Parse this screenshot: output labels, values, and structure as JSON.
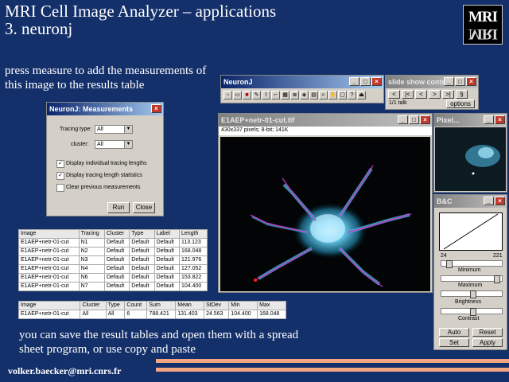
{
  "title": {
    "line1": "MRI Cell Image Analyzer – applications",
    "line2": "3. neuronj"
  },
  "logo": {
    "text": "MRI",
    "reflection": "MRI"
  },
  "instruction": "press measure to add the measurements of this image to the results table",
  "save_note": "you can save the result tables and open them with a spread sheet program, or use copy and paste",
  "footer": {
    "email": "volker.baecker@mri.cnrs.fr",
    "accent_color": "#f4a582"
  },
  "measurements_dialog": {
    "title": "NeuronJ: Measurements",
    "tracing_type_label": "Tracing type:",
    "tracing_type_value": "All",
    "cluster_label": "cluster:",
    "cluster_value": "All",
    "checkboxes": [
      {
        "label": "Display individual tracing lengths",
        "checked": true
      },
      {
        "label": "Display tracing length statistics",
        "checked": true
      },
      {
        "label": "Clear previous measurements",
        "checked": false
      }
    ],
    "run_label": "Run",
    "close_label": "Close"
  },
  "results_table": {
    "headers": [
      "Image",
      "Tracing",
      "Cluster",
      "Type",
      "Label",
      "Length"
    ],
    "rows": [
      [
        "E1AEP+netr-01-cut",
        "N1",
        "Default",
        "Default",
        "Default",
        "113.123"
      ],
      [
        "E1AEP+netr-01-cut",
        "N2",
        "Default",
        "Default",
        "Default",
        "168.048"
      ],
      [
        "E1AEP+netr-01-cut",
        "N3",
        "Default",
        "Default",
        "Default",
        "121.976"
      ],
      [
        "E1AEP+netr-01-cut",
        "N4",
        "Default",
        "Default",
        "Default",
        "127.052"
      ],
      [
        "E1AEP+netr-01-cut",
        "N6",
        "Default",
        "Default",
        "Default",
        "153.822"
      ],
      [
        "E1AEP+netr-01-cut",
        "N7",
        "Default",
        "Default",
        "Default",
        "104.400"
      ]
    ]
  },
  "stats_table": {
    "headers": [
      "Image",
      "Cluster",
      "Type",
      "Count",
      "Sum",
      "Mean",
      "StDev",
      "Min",
      "Max"
    ],
    "rows": [
      [
        "E1AEP+netr-01-cut",
        "All",
        "All",
        "6",
        "788.421",
        "131.403",
        "24.563",
        "104.400",
        "168.048"
      ]
    ]
  },
  "neuronj": {
    "title": "NeuronJ"
  },
  "slideshow": {
    "title": "slide show control",
    "buttons": [
      "<",
      "|<",
      "<",
      ">",
      ">|",
      "§"
    ],
    "counter": "1/1 talk",
    "options_label": "options"
  },
  "image_window": {
    "title": "E1AEP+netr-01-cut.tif",
    "info": "430x337 pixels; 8-bit; 141K"
  },
  "pixel_window": {
    "title": "Pixel..."
  },
  "bc": {
    "title": "B&C",
    "min_value": "24",
    "max_value": "221",
    "minimum_label": "Minimum",
    "maximum_label": "Maximum",
    "brightness_label": "Brightness",
    "contrast_label": "Contrast",
    "auto_label": "Auto",
    "reset_label": "Reset",
    "set_label": "Set",
    "apply_label": "Apply"
  }
}
